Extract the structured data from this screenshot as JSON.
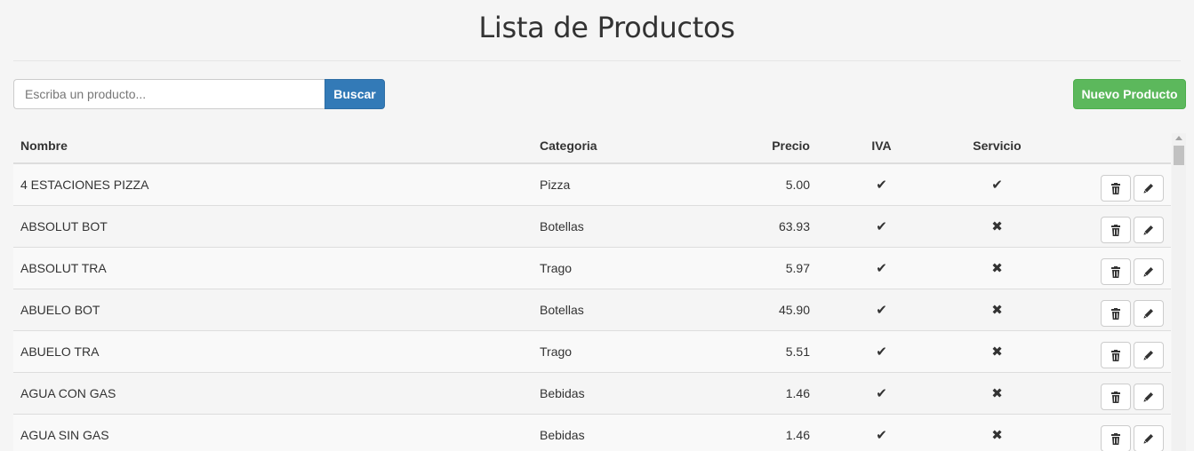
{
  "page": {
    "title": "Lista de Productos"
  },
  "search": {
    "placeholder": "Escriba un producto...",
    "value": "",
    "button_label": "Buscar"
  },
  "actions": {
    "new_product_label": "Nuevo Producto"
  },
  "table": {
    "columns": {
      "name": "Nombre",
      "category": "Categoria",
      "price": "Precio",
      "iva": "IVA",
      "service": "Servicio"
    },
    "rows": [
      {
        "name": "4 ESTACIONES PIZZA",
        "category": "Pizza",
        "price": "5.00",
        "iva": "✔",
        "service": "✔"
      },
      {
        "name": "ABSOLUT BOT",
        "category": "Botellas",
        "price": "63.93",
        "iva": "✔",
        "service": "✖"
      },
      {
        "name": "ABSOLUT TRA",
        "category": "Trago",
        "price": "5.97",
        "iva": "✔",
        "service": "✖"
      },
      {
        "name": "ABUELO BOT",
        "category": "Botellas",
        "price": "45.90",
        "iva": "✔",
        "service": "✖"
      },
      {
        "name": "ABUELO TRA",
        "category": "Trago",
        "price": "5.51",
        "iva": "✔",
        "service": "✖"
      },
      {
        "name": "AGUA CON GAS",
        "category": "Bebidas",
        "price": "1.46",
        "iva": "✔",
        "service": "✖"
      },
      {
        "name": "AGUA SIN GAS",
        "category": "Bebidas",
        "price": "1.46",
        "iva": "✔",
        "service": "✖"
      }
    ],
    "row_actions": {
      "delete_icon": "trash-icon",
      "edit_icon": "pencil-icon"
    }
  },
  "colors": {
    "primary": "#337ab7",
    "success": "#5cb85c",
    "background": "#f5f5f5"
  }
}
